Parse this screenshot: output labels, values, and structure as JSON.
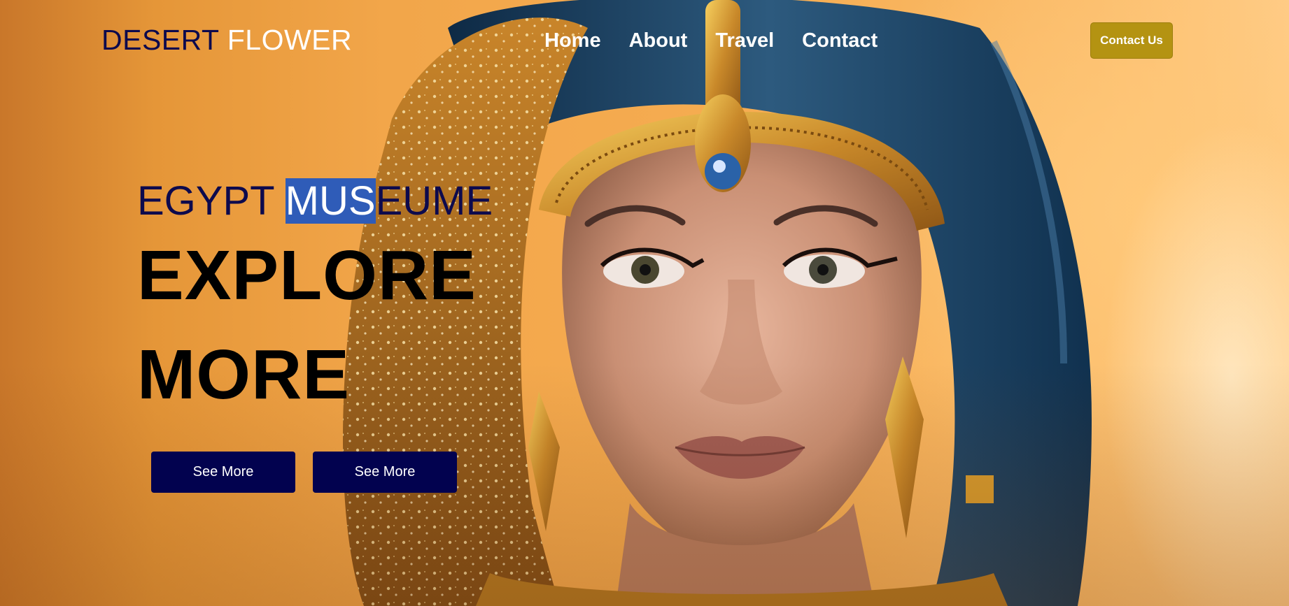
{
  "header": {
    "logo_word1": "DESERT",
    "logo_word2": "FLOWER",
    "nav": [
      "Home",
      "About",
      "Travel",
      "Contact"
    ],
    "contact_button": "Contact Us"
  },
  "hero": {
    "subtitle_part1": "EGYPT ",
    "subtitle_highlight": "MUS",
    "subtitle_part2": "EUME",
    "headline_line1": "EXPLORE",
    "headline_line2": "MORE",
    "button1": "See More",
    "button2": "See More"
  },
  "colors": {
    "background_orange": "#f2a64a",
    "navy": "#0d0a4d",
    "button_navy": "#02024f",
    "contact_gold": "#b49312",
    "highlight_blue": "#2f5cb8"
  },
  "icons": [
    "portrait-image"
  ]
}
